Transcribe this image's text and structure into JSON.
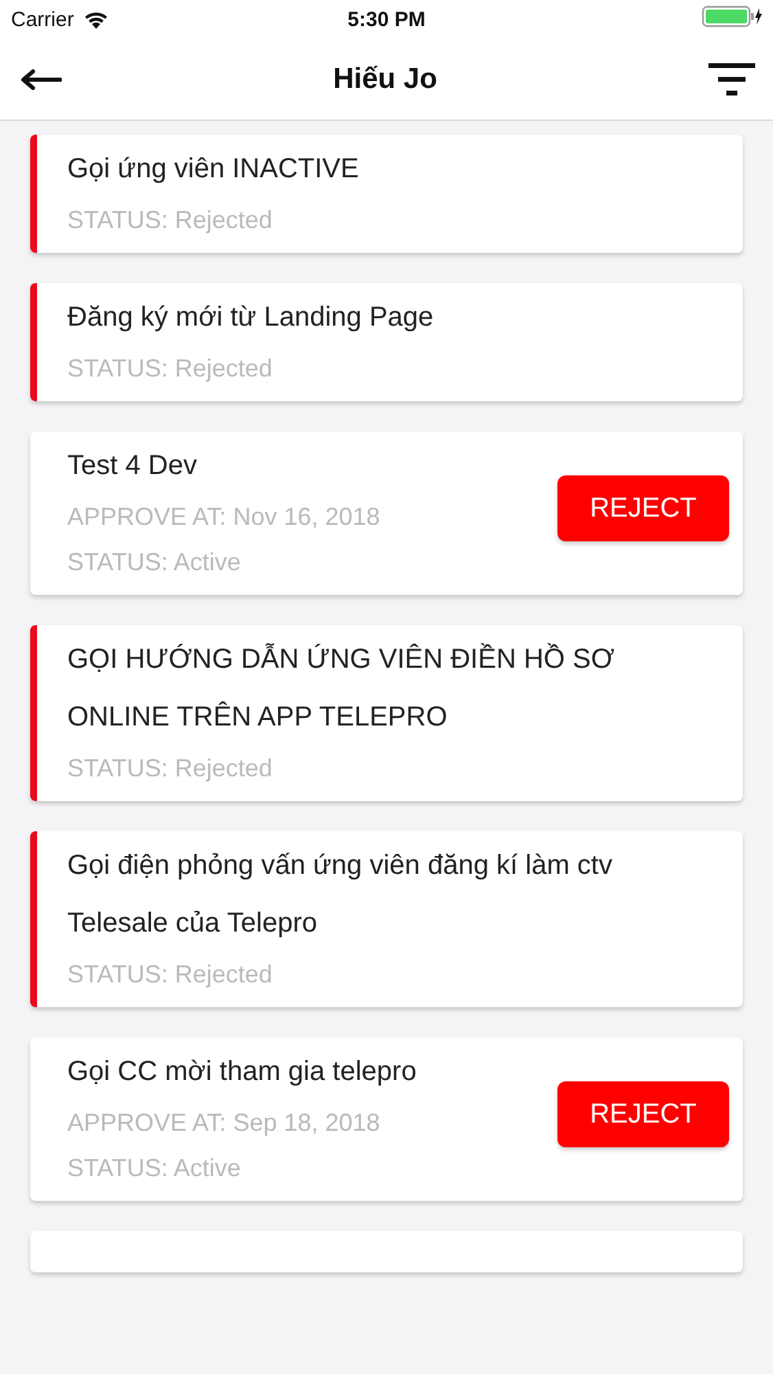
{
  "status_bar": {
    "carrier": "Carrier",
    "time": "5:30 PM"
  },
  "nav": {
    "title": "Hiếu Jo"
  },
  "tasks": [
    {
      "kind": "rejected",
      "title": "Gọi ứng viên INACTIVE",
      "status": "STATUS: Rejected"
    },
    {
      "kind": "rejected",
      "title": "Đăng ký mới từ Landing Page",
      "status": "STATUS: Rejected"
    },
    {
      "kind": "active",
      "title": "Test 4 Dev",
      "approved": "APPROVE AT: Nov 16, 2018",
      "status": "STATUS: Active",
      "button": "REJECT"
    },
    {
      "kind": "rejected",
      "title": "GỌI HƯỚNG DẪN ỨNG VIÊN ĐIỀN HỒ SƠ ONLINE TRÊN APP TELEPRO",
      "status": "STATUS: Rejected"
    },
    {
      "kind": "rejected",
      "title": "Gọi điện phỏng vấn ứng viên đăng kí làm  ctv Telesale của Telepro",
      "status": "STATUS: Rejected"
    },
    {
      "kind": "active",
      "title": "Gọi CC mời tham gia telepro",
      "approved": "APPROVE AT: Sep 18, 2018",
      "status": "STATUS: Active",
      "button": "REJECT"
    }
  ]
}
